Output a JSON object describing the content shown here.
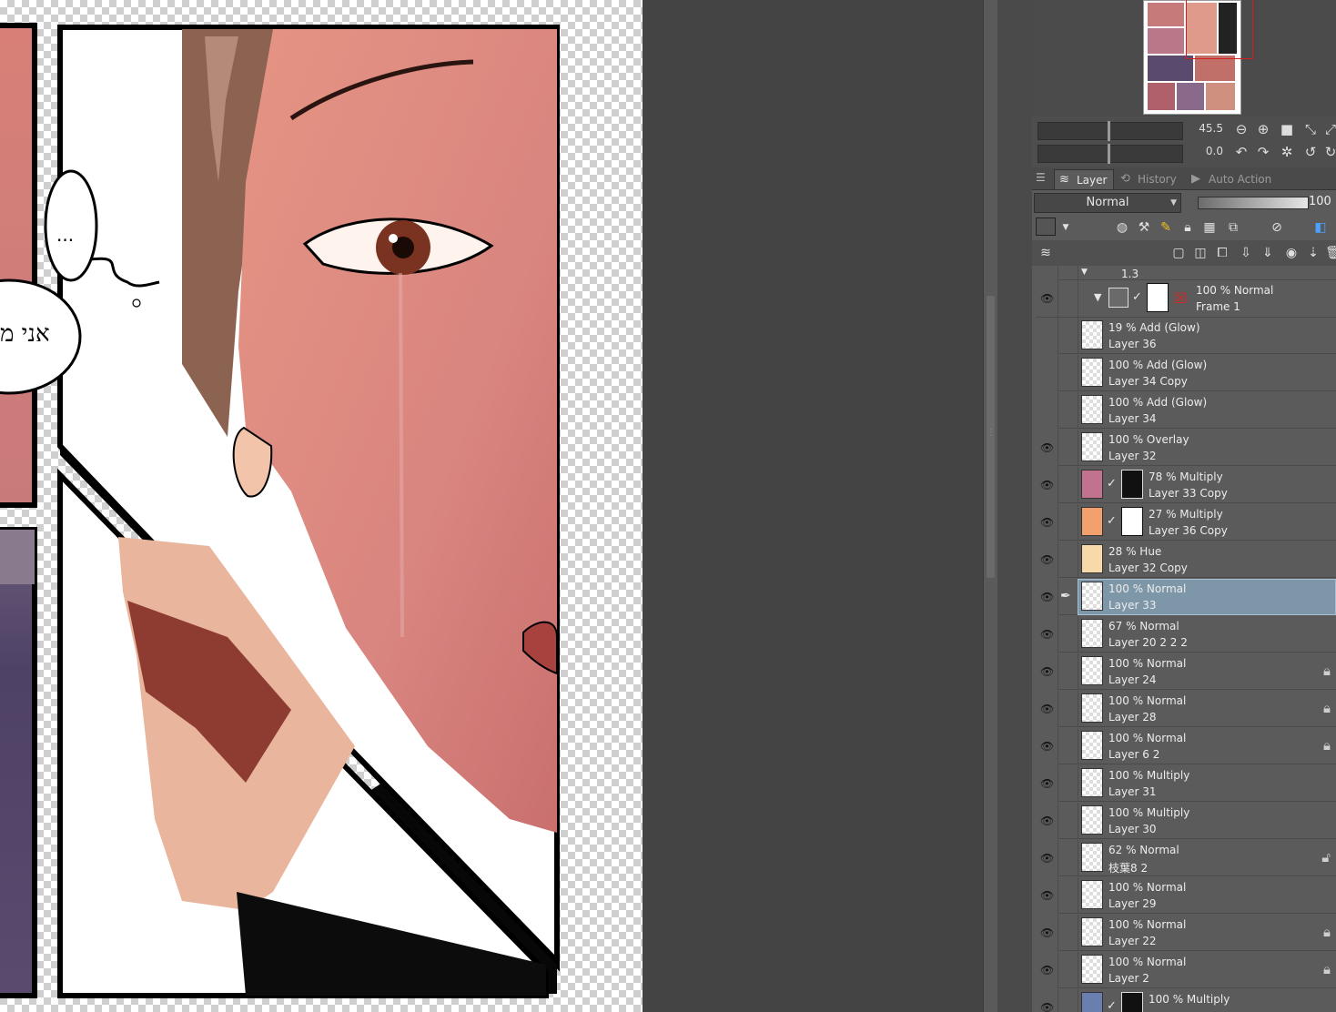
{
  "canvas": {
    "thought_bubble_text": "...",
    "speech_bubble_text": "אני מ"
  },
  "navigator": {
    "zoom_value": "45.5",
    "rotation_value": "0.0"
  },
  "tabs": [
    {
      "label": "Layer",
      "icon": "layers-icon"
    },
    {
      "label": "History",
      "icon": "history-icon"
    },
    {
      "label": "Auto Action",
      "icon": "auto-action-icon"
    }
  ],
  "layer_panel": {
    "blend_mode": "Normal",
    "opacity": "100",
    "partial_folder_label": "1.3"
  },
  "layers": [
    {
      "line1": "100 % Normal",
      "line2": "Frame 1",
      "visible": true,
      "type": "frame-folder"
    },
    {
      "line1": "19 % Add (Glow)",
      "line2": "Layer 36",
      "visible": false,
      "type": "raster"
    },
    {
      "line1": "100 % Add (Glow)",
      "line2": "Layer 34 Copy",
      "visible": false,
      "type": "raster"
    },
    {
      "line1": "100 % Add (Glow)",
      "line2": "Layer 34",
      "visible": false,
      "type": "raster"
    },
    {
      "line1": "100 % Overlay",
      "line2": "Layer 32",
      "visible": true,
      "type": "raster"
    },
    {
      "line1": "78 % Multiply",
      "line2": "Layer 33 Copy",
      "visible": true,
      "type": "masked",
      "thumb_color": "#c0728e"
    },
    {
      "line1": "27 % Multiply",
      "line2": "Layer 36 Copy",
      "visible": true,
      "type": "masked",
      "thumb_color": "#f2a06e"
    },
    {
      "line1": "28 % Hue",
      "line2": "Layer 32 Copy",
      "visible": true,
      "type": "raster",
      "thumb_color": "#f8d9a8"
    },
    {
      "line1": "100 % Normal",
      "line2": "Layer 33",
      "visible": true,
      "type": "raster",
      "selected": true
    },
    {
      "line1": "67 % Normal",
      "line2": "Layer 20 2 2 2",
      "visible": true,
      "type": "raster"
    },
    {
      "line1": "100 % Normal",
      "line2": "Layer 24",
      "visible": true,
      "type": "raster",
      "locked": true
    },
    {
      "line1": "100 % Normal",
      "line2": "Layer 28",
      "visible": true,
      "type": "raster",
      "locked": true
    },
    {
      "line1": "100 % Normal",
      "line2": "Layer 6 2",
      "visible": true,
      "type": "raster",
      "locked": true
    },
    {
      "line1": "100 % Multiply",
      "line2": "Layer 31",
      "visible": true,
      "type": "raster"
    },
    {
      "line1": "100 % Multiply",
      "line2": "Layer 30",
      "visible": true,
      "type": "raster"
    },
    {
      "line1": "62 % Normal",
      "line2": "枝葉8 2",
      "visible": true,
      "type": "raster",
      "locked": true
    },
    {
      "line1": "100 % Normal",
      "line2": "Layer 29",
      "visible": true,
      "type": "raster"
    },
    {
      "line1": "100 % Normal",
      "line2": "Layer 22",
      "visible": true,
      "type": "raster",
      "locked": true
    },
    {
      "line1": "100 % Normal",
      "line2": "Layer 2",
      "visible": true,
      "type": "raster",
      "locked": true
    },
    {
      "line1": "100 % Multiply",
      "line2": "",
      "visible": true,
      "type": "masked",
      "thumb_color": "#6a7fb0"
    }
  ],
  "colors": {
    "selected_row": "#7e97a8",
    "panel_bg": "#5b5b5b",
    "app_bg": "#444444"
  }
}
